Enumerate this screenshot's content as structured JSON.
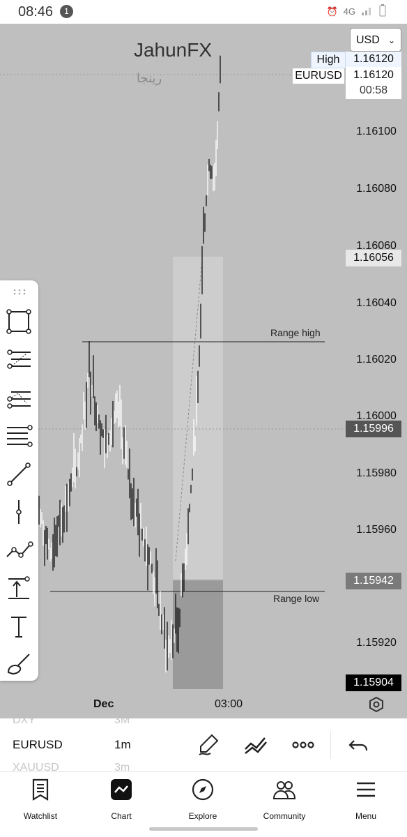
{
  "status_bar": {
    "time": "08:46",
    "notification_count": "1",
    "network": "4G"
  },
  "chart": {
    "title": "JahunFX",
    "watermark": "رینجا",
    "currency": "USD",
    "legend": {
      "high_label": "High",
      "high_value": "1.16120",
      "symbol": "EURUSD",
      "symbol_value": "1.16120",
      "countdown": "00:58"
    },
    "price_axis": [
      "1.16100",
      "1.16080",
      "1.16060",
      "1.16040",
      "1.16020",
      "1.16000",
      "1.15980",
      "1.15960",
      "1.15920"
    ],
    "price_tags": {
      "box1": "1.16056",
      "box2": "1.15996",
      "box3": "1.15942",
      "box4": "1.15904"
    },
    "time_axis": [
      "Dec",
      "03:00"
    ],
    "annotations": {
      "range_high": "Range high",
      "range_low": "Range low"
    },
    "accent_colors": {
      "background": "#bfbfbf",
      "tag_dark": "#555555",
      "tag_black": "#000000"
    }
  },
  "drawing_tools": [
    "rectangle-tool-icon",
    "fib-retracement-icon",
    "fib-extension-icon",
    "parallel-lines-icon",
    "trend-line-icon",
    "vertical-line-icon",
    "path-icon",
    "measure-icon",
    "text-tool-icon",
    "brush-icon"
  ],
  "watchlist_strip": {
    "rows": [
      {
        "symbol": "DXY",
        "timeframe": "3M"
      },
      {
        "symbol": "EURUSD",
        "timeframe": "1m"
      },
      {
        "symbol": "XAUUSD",
        "timeframe": "3m"
      }
    ]
  },
  "bottom_nav": {
    "items": [
      {
        "label": "Watchlist",
        "icon": "watchlist-icon"
      },
      {
        "label": "Chart",
        "icon": "chart-icon"
      },
      {
        "label": "Explore",
        "icon": "compass-icon"
      },
      {
        "label": "Community",
        "icon": "community-icon"
      },
      {
        "label": "Menu",
        "icon": "hamburger-icon"
      }
    ]
  }
}
